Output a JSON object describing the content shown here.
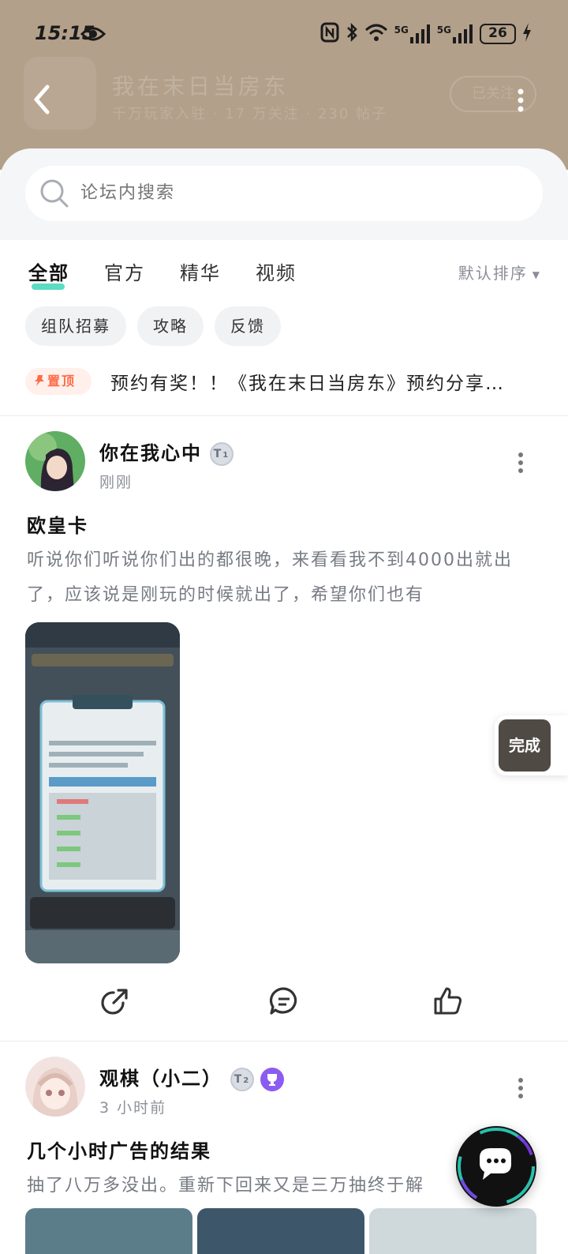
{
  "status_bar": {
    "time": "15:15",
    "battery": "26",
    "net1": "5G",
    "net2": "5G"
  },
  "hero": {
    "title": "我在末日当房东",
    "subtitle": "千万玩家入驻 · 17 万关注 · 230 帖子",
    "joined": "已关注"
  },
  "search": {
    "placeholder": "论坛内搜索"
  },
  "tabs": [
    {
      "label": "全部"
    },
    {
      "label": "官方"
    },
    {
      "label": "精华"
    },
    {
      "label": "视频"
    }
  ],
  "sort": {
    "label": "默认排序"
  },
  "chips": [
    {
      "label": "组队招募"
    },
    {
      "label": "攻略"
    },
    {
      "label": "反馈"
    }
  ],
  "pinned": {
    "badge": "置顶",
    "text": "预约有奖！！《我在末日当房东》预约分享…"
  },
  "posts": [
    {
      "author": "你在我心中",
      "level": "1",
      "time": "刚刚",
      "title": "欧皇卡",
      "body": "听说你们听说你们出的都很晚，来看看我不到4000出就出了，应该说是刚玩的时候就出了，希望你们也有"
    },
    {
      "author": "观棋（小二）",
      "level": "2",
      "time": "3 小时前",
      "title": "几个小时广告的结果",
      "body": "抽了八万多没出。重新下回来又是三万抽终于解"
    }
  ],
  "float_done": {
    "label": "完成"
  }
}
